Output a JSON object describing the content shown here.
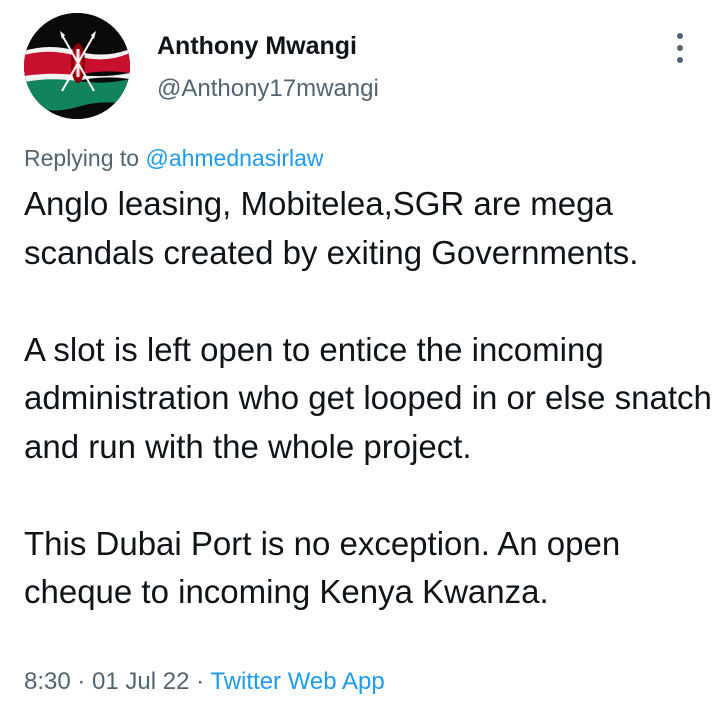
{
  "author": {
    "display_name": "Anthony Mwangi",
    "handle": "@Anthony17mwangi",
    "avatar_icon": "kenya-flag-avatar"
  },
  "more_icon": "more-options-vertical-icon",
  "reply": {
    "prefix": "Replying to ",
    "mention": "@ahmednasirlaw"
  },
  "tweet": {
    "paragraphs": [
      "Anglo leasing, Mobitelea,SGR are mega scandals created by exiting Governments.",
      "A slot is left open to entice the incoming administration who get looped in or else snatch and run with the whole project.",
      "This Dubai Port is no exception. An open cheque  to incoming Kenya Kwanza."
    ]
  },
  "meta": {
    "time": "8:30",
    "separator1": " · ",
    "date": "01 Jul 22",
    "separator2": " · ",
    "source": "Twitter Web App"
  },
  "colors": {
    "text": "#0f1419",
    "secondary": "#536471",
    "link": "#1d9bf0",
    "flag_red": "#c8102e",
    "flag_green": "#11845b"
  }
}
